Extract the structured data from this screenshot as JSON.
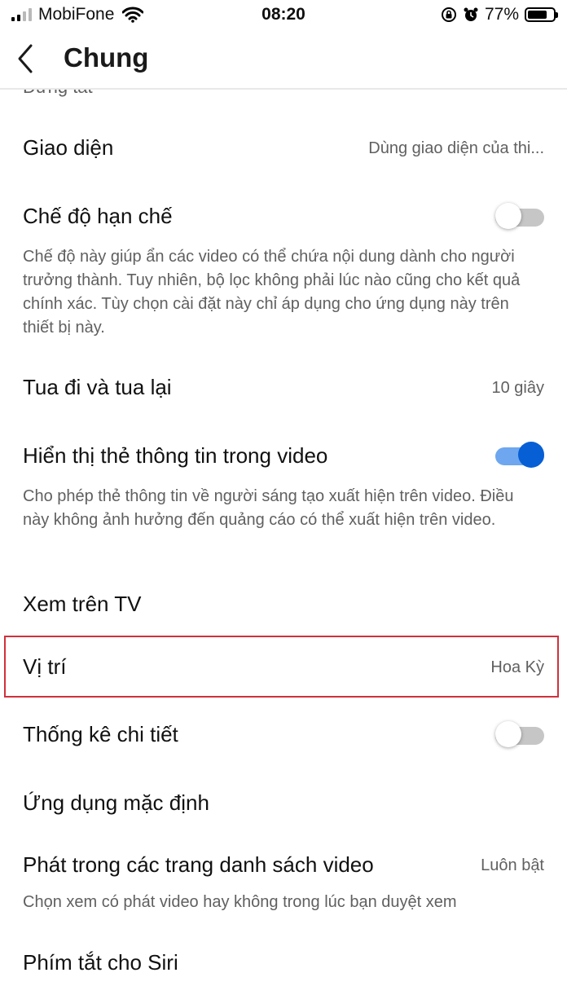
{
  "status_bar": {
    "carrier": "MobiFone",
    "time": "08:20",
    "battery": "77%",
    "battery_level_percent": 77,
    "icons": [
      "cellular-signal-icon",
      "wifi-icon",
      "rotation-lock-icon",
      "alarm-clock-icon",
      "battery-icon"
    ]
  },
  "nav": {
    "title": "Chung",
    "back_icon": "chevron-left-icon"
  },
  "peek_text": "Dừng tắt",
  "settings": {
    "appearance": {
      "label": "Giao diện",
      "value": "Dùng giao diện của thi..."
    },
    "restricted_mode": {
      "label": "Chế độ hạn chế",
      "enabled": false,
      "description": "Chế độ này giúp ẩn các video có thể chứa nội dung dành cho người trưởng thành. Tuy nhiên, bộ lọc không phải lúc nào cũng cho kết quả chính xác. Tùy chọn cài đặt này chỉ áp dụng cho ứng dụng này trên thiết bị này."
    },
    "seek": {
      "label": "Tua đi và tua lại",
      "value": "10 giây"
    },
    "info_cards": {
      "label": "Hiển thị thẻ thông tin trong video",
      "enabled": true,
      "description": "Cho phép thẻ thông tin về người sáng tạo xuất hiện trên video. Điều này không ảnh hưởng đến quảng cáo có thể xuất hiện trên video."
    },
    "watch_on_tv": {
      "label": "Xem trên TV"
    },
    "location": {
      "label": "Vị trí",
      "value": "Hoa Kỳ",
      "highlight_color": "#d0313c"
    },
    "stats_for_nerds": {
      "label": "Thống kê chi tiết",
      "enabled": false
    },
    "default_apps": {
      "label": "Ứng dụng mặc định"
    },
    "playback_in_feeds": {
      "label": "Phát trong các trang danh sách video",
      "value": "Luôn bật",
      "description": "Chọn xem có phát video hay không trong lúc bạn duyệt xem"
    },
    "siri_shortcuts": {
      "label": "Phím tắt cho Siri"
    }
  },
  "colors": {
    "accent_blue": "#065fd4",
    "toggle_on_track": "#6ea6ef",
    "toggle_off_track": "#c6c6c6",
    "secondary_text": "#606060"
  }
}
